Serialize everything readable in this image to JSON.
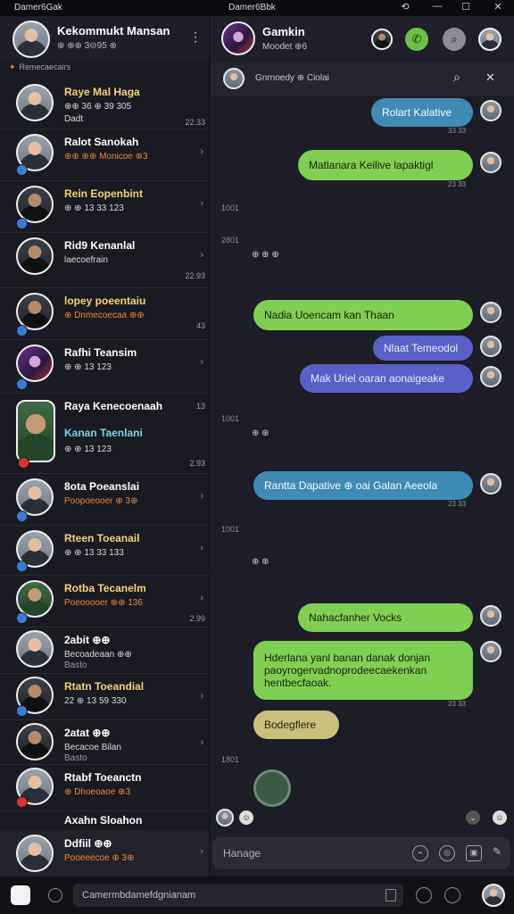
{
  "window": {
    "left_title": "Damer6Gak",
    "right_title": "Damer6Bbk"
  },
  "profile": {
    "name": "Kekommukt Mansan",
    "status": "⊕ ⊕⊕ 3⊖95 ⊕"
  },
  "section_label": "Remecaecairs",
  "chats": [
    {
      "name": "Raye Mal Haga",
      "msg": "⊕⊕ 36 ⊕ 39 305",
      "time": "22.33",
      "sub": "Dadt"
    },
    {
      "name": "Ralot Sanokah",
      "msg": "⊕⊕ ⊕⊕ Monicoe ⊕3",
      "time": ""
    },
    {
      "name": "Rein Eopenbint",
      "msg": "⊕ ⊕ 13 33 123",
      "time": ""
    },
    {
      "name": "Rid9 Kenanlal",
      "msg": "laecoefrain",
      "time": "22.93"
    },
    {
      "name": "lopey poeentaiu",
      "msg": "⊕ Dnmecoecaa ⊕⊕",
      "time": "43"
    },
    {
      "name": "Rafhi Teansim",
      "msg": "⊕ ⊕ 13 123",
      "time": ""
    },
    {
      "name": "Raya Kenecoenaah",
      "msg": "",
      "time": "13"
    },
    {
      "name": "Kanan Taenlani",
      "msg": "⊕ ⊕ 13 123",
      "time": "2.93"
    },
    {
      "name": "8ota Poeanslai",
      "msg": "Poopoeooer ⊕ 3⊕",
      "time": ""
    },
    {
      "name": "Rteen Toeanail",
      "msg": "⊕ ⊕ 13 33 133",
      "time": ""
    },
    {
      "name": "Rotba Tecanelm",
      "msg": "Poeooooer ⊕⊕ 136",
      "time": "2.99"
    },
    {
      "name": "2abit ⊕⊕",
      "msg": "Becoadeaan ⊕⊕",
      "time": "",
      "sub": "Basto"
    },
    {
      "name": "Rtatn Toeandial",
      "msg": "22 ⊕ 13 59 330",
      "time": ""
    },
    {
      "name": "2atat ⊕⊕",
      "msg": "Becacoe Bilan",
      "time": "",
      "sub": "Basto"
    },
    {
      "name": "Rtabf Toeanctn",
      "msg": "⊕ Dhoeoaoe ⊕3",
      "time": ""
    },
    {
      "name": "Axahn Sloahon",
      "msg": "",
      "time": ""
    }
  ],
  "self": {
    "name": "Ddfiil ⊕⊕",
    "status": "Pooeeecoe ⊕ 3⊕"
  },
  "conversation": {
    "title": "Gamkin",
    "subtitle": "Moodet ⊕6",
    "banner": "Gnrnoedy ⊕ Ciolai"
  },
  "messages": [
    {
      "text": "Rolart Kalative",
      "stamp": "33 33",
      "style": "blue"
    },
    {
      "text": "Matlanara Keilive lapaktigl",
      "stamp": "23 33",
      "style": "green"
    },
    {
      "text": "Nadia Uoencam kan Thaan",
      "stamp": "",
      "style": "green"
    },
    {
      "text": "Nlaat Temeodol",
      "stamp": "",
      "style": "purple"
    },
    {
      "text": "Mak Uriel oaran aonaigeake",
      "stamp": "",
      "style": "purple"
    },
    {
      "text": "Rantta Dapative ⊕ oai Galan Aeeola",
      "stamp": "23 33",
      "style": "blue"
    },
    {
      "text": "Nahacfanher Vocks",
      "stamp": "",
      "style": "green"
    },
    {
      "text": "Hderlana yanl banan danak donjan",
      "text2": "paoyrogervadnoprodeecaekenkan",
      "text3": "hentbecfaoak.",
      "stamp": "23 33",
      "style": "green"
    },
    {
      "text": "Bodegflere",
      "stamp": "",
      "style": "tan"
    }
  ],
  "side_times": [
    "1001",
    "2801",
    "1001",
    "1001",
    "1801"
  ],
  "reaction_rows": [
    "⊕ ⊕ ⊕",
    "⊕ ⊕",
    "⊕ ⊕"
  ],
  "composer": {
    "placeholder": "Hanage"
  },
  "bottom": {
    "search_text": "Camermbdamefdgnianam"
  },
  "colors": {
    "accent_blue": "#3f8bb5",
    "accent_green": "#7fcf52",
    "accent_purple": "#5a5fc8",
    "name_gold": "#f3d37a"
  }
}
